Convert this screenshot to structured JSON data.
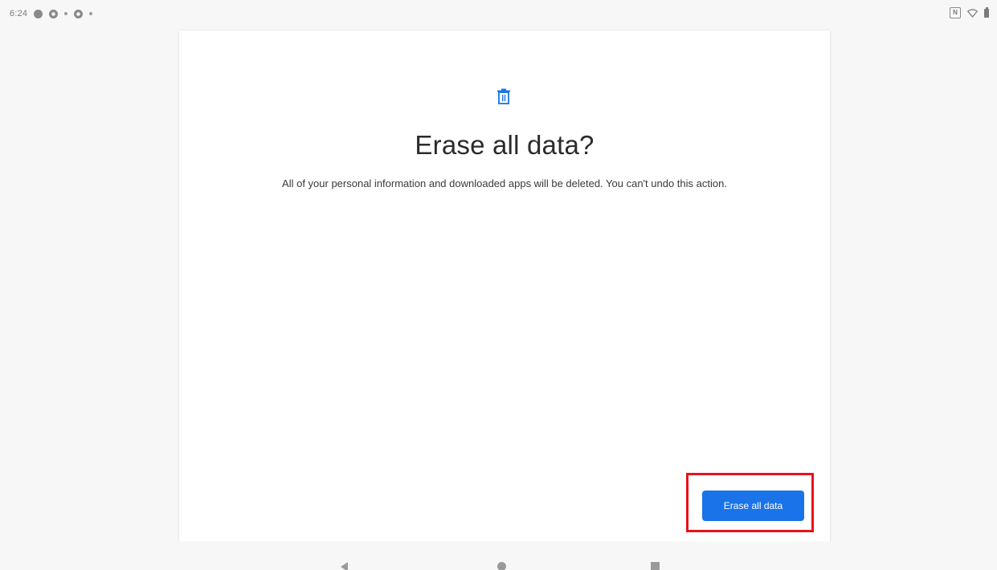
{
  "status_bar": {
    "time": "6:24",
    "left_icons": [
      "status-app-icon",
      "settings-icon",
      "status-dot-icon",
      "settings-icon",
      "status-dot-icon"
    ],
    "right_icons": [
      "nfc-icon",
      "wifi-icon",
      "battery-icon"
    ]
  },
  "dialog": {
    "icon": "trash-icon",
    "title": "Erase all data?",
    "description": "All of your personal information and downloaded apps will be deleted. You can't undo this action.",
    "primary_button": "Erase all data"
  },
  "nav_bar": {
    "icons": [
      "back-icon",
      "home-icon",
      "recents-icon"
    ]
  },
  "colors": {
    "accent": "#1a73e8",
    "highlight": "#e8121b",
    "background": "#f7f7f7"
  }
}
